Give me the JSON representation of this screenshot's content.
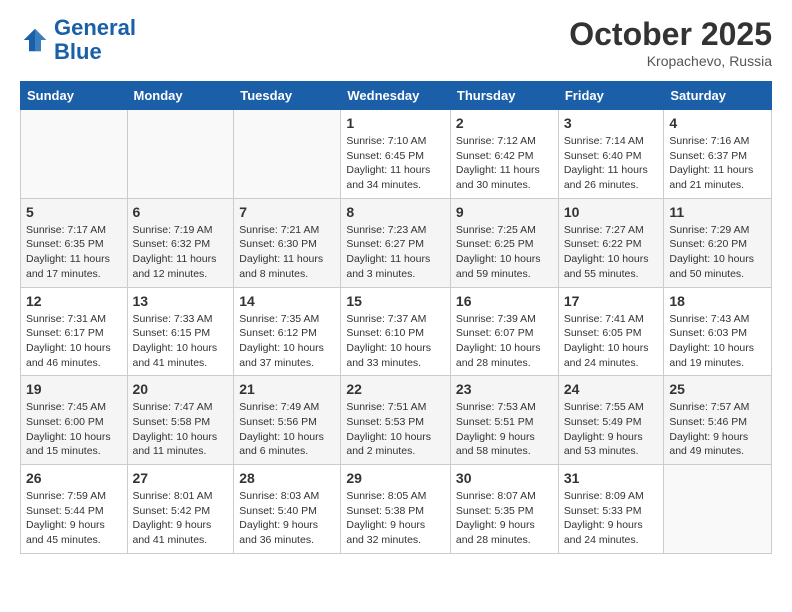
{
  "header": {
    "logo_line1": "General",
    "logo_line2": "Blue",
    "month": "October 2025",
    "location": "Kropachevo, Russia"
  },
  "days_of_week": [
    "Sunday",
    "Monday",
    "Tuesday",
    "Wednesday",
    "Thursday",
    "Friday",
    "Saturday"
  ],
  "weeks": [
    [
      {
        "day": "",
        "info": ""
      },
      {
        "day": "",
        "info": ""
      },
      {
        "day": "",
        "info": ""
      },
      {
        "day": "1",
        "info": "Sunrise: 7:10 AM\nSunset: 6:45 PM\nDaylight: 11 hours and 34 minutes."
      },
      {
        "day": "2",
        "info": "Sunrise: 7:12 AM\nSunset: 6:42 PM\nDaylight: 11 hours and 30 minutes."
      },
      {
        "day": "3",
        "info": "Sunrise: 7:14 AM\nSunset: 6:40 PM\nDaylight: 11 hours and 26 minutes."
      },
      {
        "day": "4",
        "info": "Sunrise: 7:16 AM\nSunset: 6:37 PM\nDaylight: 11 hours and 21 minutes."
      }
    ],
    [
      {
        "day": "5",
        "info": "Sunrise: 7:17 AM\nSunset: 6:35 PM\nDaylight: 11 hours and 17 minutes."
      },
      {
        "day": "6",
        "info": "Sunrise: 7:19 AM\nSunset: 6:32 PM\nDaylight: 11 hours and 12 minutes."
      },
      {
        "day": "7",
        "info": "Sunrise: 7:21 AM\nSunset: 6:30 PM\nDaylight: 11 hours and 8 minutes."
      },
      {
        "day": "8",
        "info": "Sunrise: 7:23 AM\nSunset: 6:27 PM\nDaylight: 11 hours and 3 minutes."
      },
      {
        "day": "9",
        "info": "Sunrise: 7:25 AM\nSunset: 6:25 PM\nDaylight: 10 hours and 59 minutes."
      },
      {
        "day": "10",
        "info": "Sunrise: 7:27 AM\nSunset: 6:22 PM\nDaylight: 10 hours and 55 minutes."
      },
      {
        "day": "11",
        "info": "Sunrise: 7:29 AM\nSunset: 6:20 PM\nDaylight: 10 hours and 50 minutes."
      }
    ],
    [
      {
        "day": "12",
        "info": "Sunrise: 7:31 AM\nSunset: 6:17 PM\nDaylight: 10 hours and 46 minutes."
      },
      {
        "day": "13",
        "info": "Sunrise: 7:33 AM\nSunset: 6:15 PM\nDaylight: 10 hours and 41 minutes."
      },
      {
        "day": "14",
        "info": "Sunrise: 7:35 AM\nSunset: 6:12 PM\nDaylight: 10 hours and 37 minutes."
      },
      {
        "day": "15",
        "info": "Sunrise: 7:37 AM\nSunset: 6:10 PM\nDaylight: 10 hours and 33 minutes."
      },
      {
        "day": "16",
        "info": "Sunrise: 7:39 AM\nSunset: 6:07 PM\nDaylight: 10 hours and 28 minutes."
      },
      {
        "day": "17",
        "info": "Sunrise: 7:41 AM\nSunset: 6:05 PM\nDaylight: 10 hours and 24 minutes."
      },
      {
        "day": "18",
        "info": "Sunrise: 7:43 AM\nSunset: 6:03 PM\nDaylight: 10 hours and 19 minutes."
      }
    ],
    [
      {
        "day": "19",
        "info": "Sunrise: 7:45 AM\nSunset: 6:00 PM\nDaylight: 10 hours and 15 minutes."
      },
      {
        "day": "20",
        "info": "Sunrise: 7:47 AM\nSunset: 5:58 PM\nDaylight: 10 hours and 11 minutes."
      },
      {
        "day": "21",
        "info": "Sunrise: 7:49 AM\nSunset: 5:56 PM\nDaylight: 10 hours and 6 minutes."
      },
      {
        "day": "22",
        "info": "Sunrise: 7:51 AM\nSunset: 5:53 PM\nDaylight: 10 hours and 2 minutes."
      },
      {
        "day": "23",
        "info": "Sunrise: 7:53 AM\nSunset: 5:51 PM\nDaylight: 9 hours and 58 minutes."
      },
      {
        "day": "24",
        "info": "Sunrise: 7:55 AM\nSunset: 5:49 PM\nDaylight: 9 hours and 53 minutes."
      },
      {
        "day": "25",
        "info": "Sunrise: 7:57 AM\nSunset: 5:46 PM\nDaylight: 9 hours and 49 minutes."
      }
    ],
    [
      {
        "day": "26",
        "info": "Sunrise: 7:59 AM\nSunset: 5:44 PM\nDaylight: 9 hours and 45 minutes."
      },
      {
        "day": "27",
        "info": "Sunrise: 8:01 AM\nSunset: 5:42 PM\nDaylight: 9 hours and 41 minutes."
      },
      {
        "day": "28",
        "info": "Sunrise: 8:03 AM\nSunset: 5:40 PM\nDaylight: 9 hours and 36 minutes."
      },
      {
        "day": "29",
        "info": "Sunrise: 8:05 AM\nSunset: 5:38 PM\nDaylight: 9 hours and 32 minutes."
      },
      {
        "day": "30",
        "info": "Sunrise: 8:07 AM\nSunset: 5:35 PM\nDaylight: 9 hours and 28 minutes."
      },
      {
        "day": "31",
        "info": "Sunrise: 8:09 AM\nSunset: 5:33 PM\nDaylight: 9 hours and 24 minutes."
      },
      {
        "day": "",
        "info": ""
      }
    ]
  ]
}
